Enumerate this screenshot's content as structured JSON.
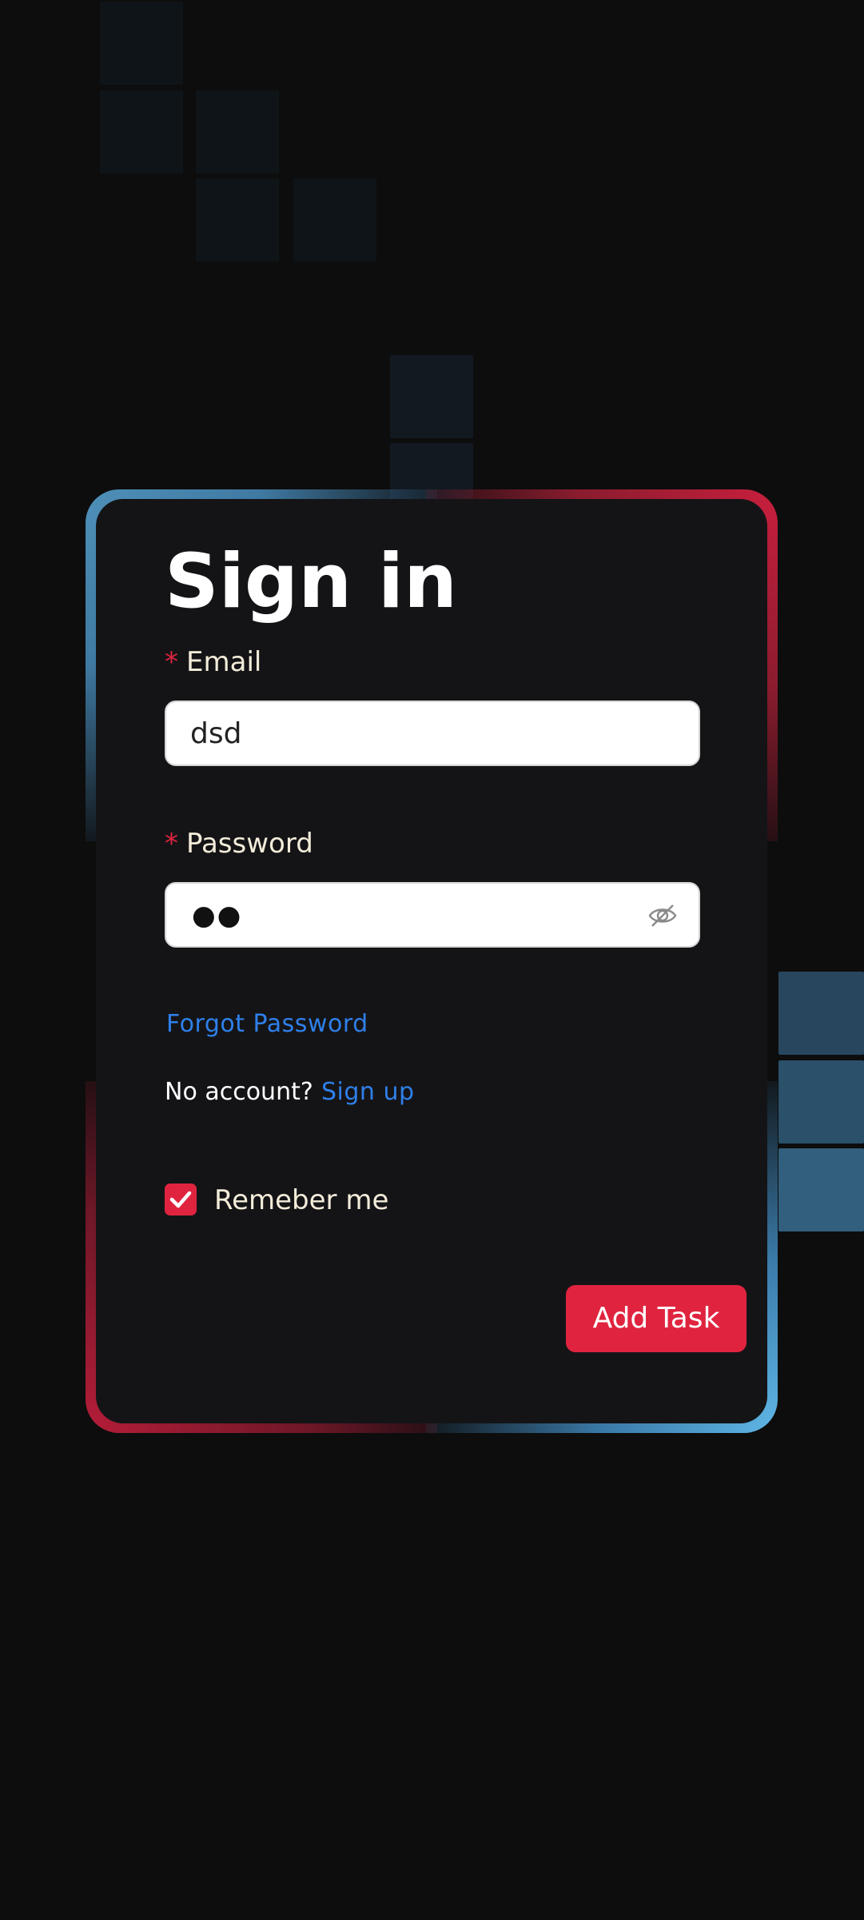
{
  "login": {
    "title": "Sign in",
    "email": {
      "required_mark": "*",
      "label": "Email",
      "value": "dsd"
    },
    "password": {
      "required_mark": "*",
      "label": "Password",
      "masked_value": "●●",
      "toggle_icon": "eye-slash-icon"
    },
    "forgot_password": "Forgot Password",
    "no_account": "No account?",
    "sign_up": "Sign up",
    "remember": {
      "label": "Remeber me",
      "checked": true
    },
    "submit_label": "Add Task"
  },
  "colors": {
    "background": "#0d0d0d",
    "card": "#141417",
    "accent_red": "#e0243f",
    "accent_blue": "#4e8fb8",
    "link": "#2f80ea"
  }
}
